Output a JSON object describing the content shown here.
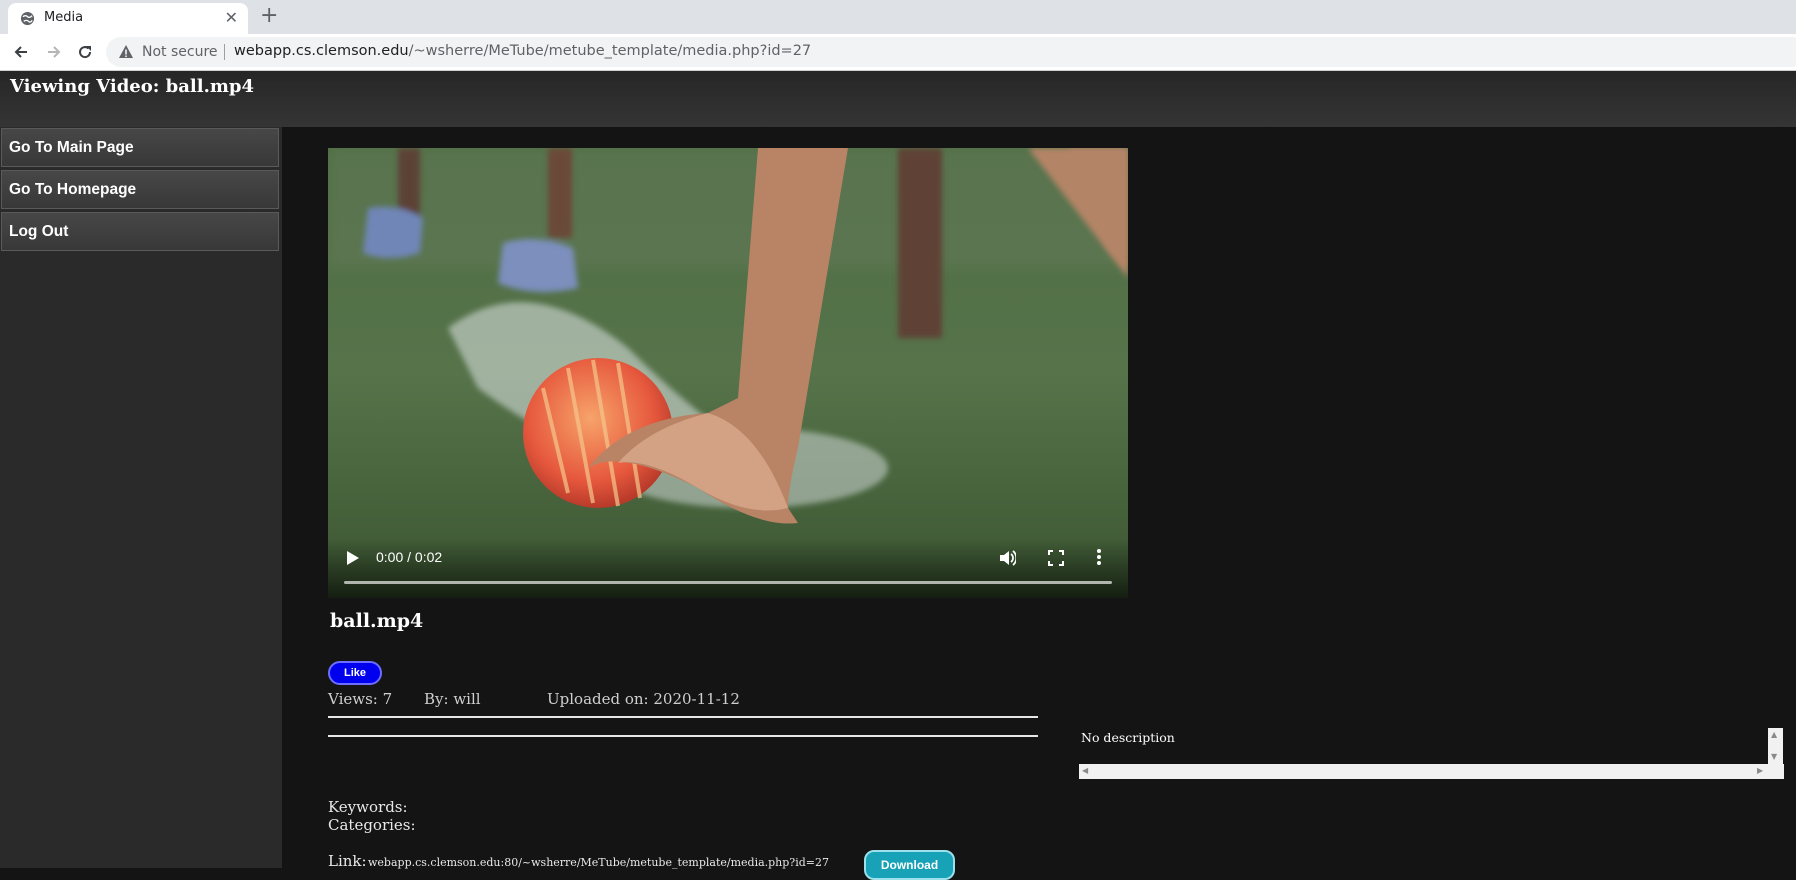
{
  "browser": {
    "tab_title": "Media",
    "close_symbol": "✕",
    "new_tab_symbol": "+",
    "security_label": "Not secure",
    "url_host": "webapp.cs.clemson.edu",
    "url_path": "/~wsherre/MeTube/metube_template/media.php?id=27",
    "icons": [
      "globe-icon",
      "back-arrow-icon",
      "forward-arrow-icon",
      "reload-icon",
      "warning-icon"
    ]
  },
  "header": {
    "title": "Viewing Video: ball.mp4"
  },
  "sidebar": {
    "items": [
      {
        "label": "Go To Main Page"
      },
      {
        "label": "Go To Homepage"
      },
      {
        "label": "Log Out"
      }
    ]
  },
  "video": {
    "timecode": "0:00 / 0:02",
    "progress": 0,
    "icons": [
      "play-icon",
      "volume-icon",
      "fullscreen-icon",
      "more-options-icon"
    ]
  },
  "media": {
    "title": "ball.mp4",
    "like_label": "Like",
    "views": "Views: 7",
    "by": "By: will",
    "uploaded": "Uploaded on: 2020-11-12",
    "description": "No description",
    "keywords_label": "Keywords:",
    "categories_label": "Categories:",
    "link_label": "Link:",
    "link_url": "webapp.cs.clemson.edu:80/~wsherre/MeTube/metube_template/media.php?id=27",
    "download_label": "Download"
  },
  "colors": {
    "like_button": "#0000ee",
    "download_button": "#17a2b8",
    "page_background": "#141414",
    "sidebar_button": "#3f3f3f"
  }
}
